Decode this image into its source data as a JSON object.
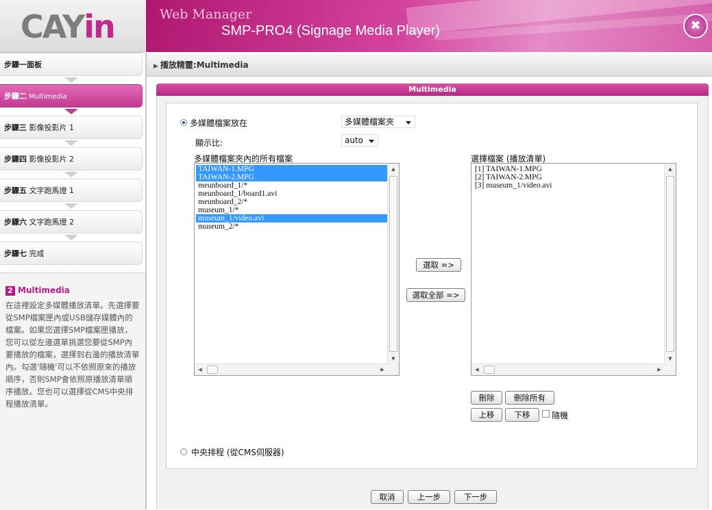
{
  "logo": {
    "part1": "CAY",
    "part2": "in"
  },
  "header": {
    "subtitle": "Web Manager",
    "model": "SMP-PRO4 (Signage Media Player)",
    "logout_icon": "power-icon"
  },
  "steps": [
    {
      "prefix": "步驟一",
      "label": "面板"
    },
    {
      "prefix": "步驟二",
      "label": " Multimedia"
    },
    {
      "prefix": "步驟三",
      "label": " 影像投影片 1"
    },
    {
      "prefix": "步驟四",
      "label": " 影像投影片 2"
    },
    {
      "prefix": "步驟五",
      "label": " 文字跑馬燈 1"
    },
    {
      "prefix": "步驟六",
      "label": " 文字跑馬燈 2"
    },
    {
      "prefix": "步驟七",
      "label": " 完成"
    }
  ],
  "help": {
    "number": "2",
    "title": "Multimedia",
    "text": "在這裡設定多媒體播放清單。先選擇要從SMP檔案匣內或USB儲存媒體內的檔案。如果您選擇SMP檔案匣播放，您可以從左邊選單挑選您要從SMP內要播放的檔案，選擇到右邊的播放清單內。勾選'隨機'可以不依照原來的播放順序，否則SMP會依照原播放清單順序播放。您也可以選擇從CMS中央排程播放清單。"
  },
  "breadcrumb": "播放精靈:Multimedia",
  "panel": {
    "title": "Multimedia"
  },
  "form": {
    "source_label": "多媒體檔案放在",
    "source_value": "多媒體檔案夾",
    "ratio_label": "顯示比:",
    "ratio_value": "auto",
    "all_files_label": "多媒體檔案夾內的所有檔案",
    "playlist_label": "選擇檔案 (播放清單)",
    "select_btn": "選取 =>",
    "select_all_btn": "選取全部 =>",
    "delete_btn": "刪除",
    "delete_all_btn": "刪除所有",
    "up_btn": "上移",
    "down_btn": "下移",
    "random_label": "隨機",
    "central_label": "中央排程 (從CMS伺服器)"
  },
  "all_files": [
    {
      "name": "TAIWAN-1.MPG",
      "selected": true
    },
    {
      "name": "TAIWAN-2.MPG",
      "selected": true
    },
    {
      "name": "meunboard_1/*",
      "selected": false
    },
    {
      "name": "meunboard_1/board1.avi",
      "selected": false
    },
    {
      "name": "meunboard_2/*",
      "selected": false
    },
    {
      "name": "museum_1/*",
      "selected": false
    },
    {
      "name": "museum_1/video.avi",
      "selected": true
    },
    {
      "name": "museum_2/*",
      "selected": false
    }
  ],
  "playlist": [
    "[1] TAIWAN-1.MPG",
    "[2] TAIWAN-2.MPG",
    "[3] museum_1/video.avi"
  ],
  "footer": {
    "cancel": "取消",
    "prev": "上一步",
    "next": "下一步"
  }
}
